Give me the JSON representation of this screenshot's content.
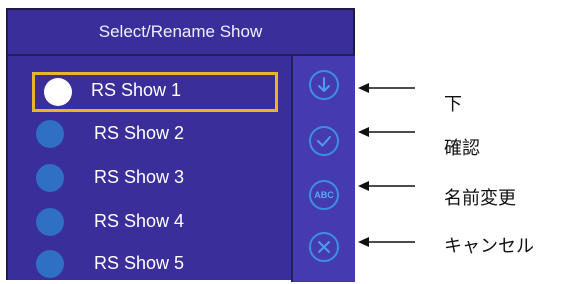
{
  "window": {
    "title": "Select/Rename Show"
  },
  "shows": [
    {
      "label": "RS Show 1",
      "selected": true
    },
    {
      "label": "RS Show 2",
      "selected": false
    },
    {
      "label": "RS Show 3",
      "selected": false
    },
    {
      "label": "RS Show 4",
      "selected": false
    },
    {
      "label": "RS Show 5",
      "selected": false
    }
  ],
  "side_buttons": {
    "down": {
      "icon": "arrow-down-circle-icon"
    },
    "confirm": {
      "icon": "check-circle-icon"
    },
    "rename": {
      "icon": "abc-circle-icon",
      "text": "ABC"
    },
    "cancel": {
      "icon": "x-circle-icon"
    }
  },
  "annotations": {
    "down": "下",
    "confirm": "確認",
    "rename": "名前変更",
    "cancel": "キャンセル"
  },
  "colors": {
    "panel": "#3a2f9a",
    "side_bar": "#463ab0",
    "selection_border": "#e8b428",
    "radio_fill": "#2f6fc4",
    "icon_stroke": "#3b8fe2"
  }
}
